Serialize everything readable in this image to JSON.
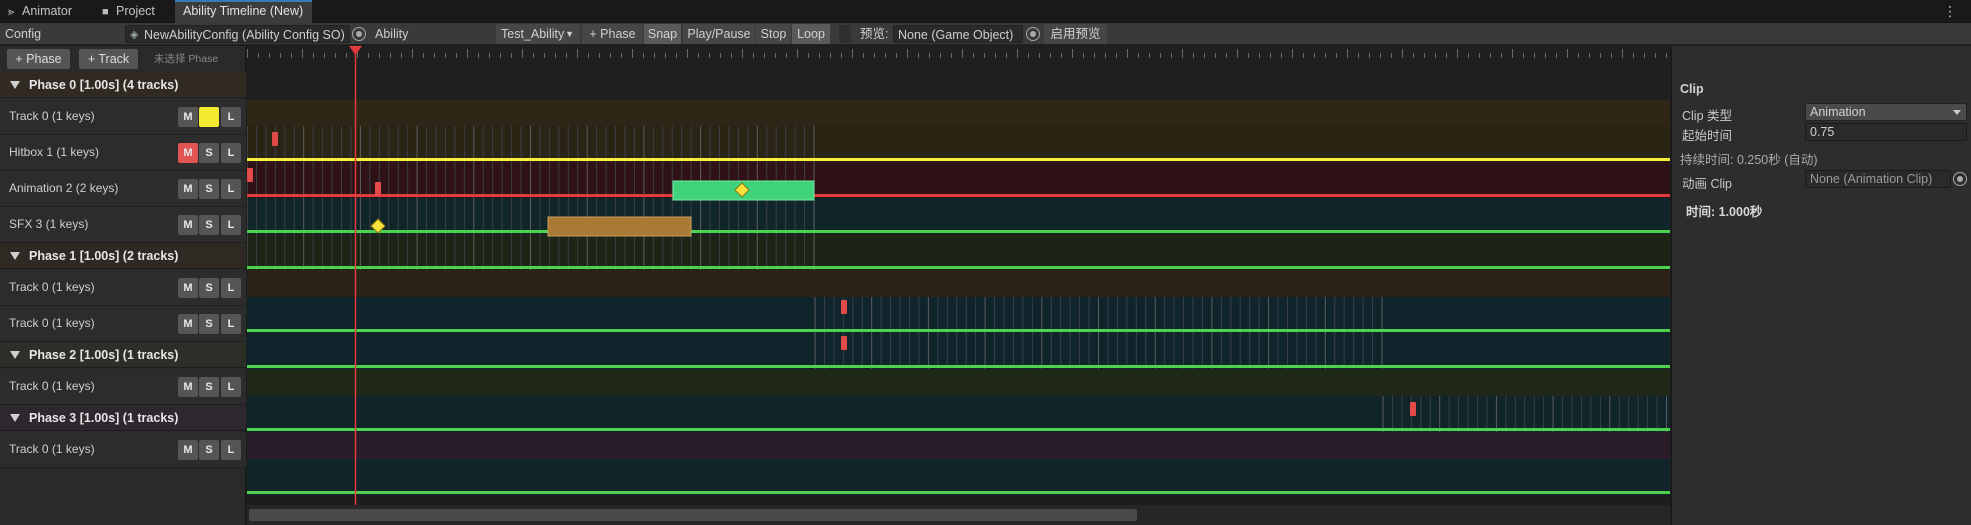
{
  "tabs": [
    {
      "label": "Animator",
      "icon": "animator-icon"
    },
    {
      "label": "Project",
      "icon": "folder-icon"
    },
    {
      "label": "Ability Timeline (New)",
      "icon": ""
    }
  ],
  "toolbar": {
    "config_label": "Config",
    "config_value": "NewAbilityConfig (Ability Config SO)",
    "ability_label": "Ability",
    "ability_value": "Test_Ability",
    "add_phase": "+ Phase",
    "snap": "Snap",
    "play_pause": "Play/Pause",
    "stop": "Stop",
    "loop": "Loop",
    "preview_label": "预览:",
    "preview_value": "None (Game Object)",
    "enable_preview": "启用预览"
  },
  "left": {
    "add_phase": "+ Phase",
    "add_track": "+ Track",
    "hint": "未选择 Phase"
  },
  "phases": [
    {
      "label": "Phase 0  [1.00s] (4 tracks)",
      "tracks": [
        {
          "label": "Track 0 (1 keys)",
          "m": "M",
          "s": "",
          "l": "L",
          "m_state": "normal",
          "s_state": "yellow"
        },
        {
          "label": "Hitbox 1 (1 keys)",
          "m": "M",
          "s": "S",
          "l": "L",
          "m_state": "red",
          "s_state": "normal"
        },
        {
          "label": "Animation 2 (2 keys)",
          "m": "M",
          "s": "S",
          "l": "L",
          "m_state": "normal",
          "s_state": "normal"
        },
        {
          "label": "SFX 3 (1 keys)",
          "m": "M",
          "s": "S",
          "l": "L",
          "m_state": "normal",
          "s_state": "normal"
        }
      ]
    },
    {
      "label": "Phase 1  [1.00s] (2 tracks)",
      "tracks": [
        {
          "label": "Track 0 (1 keys)",
          "m": "M",
          "s": "S",
          "l": "L",
          "m_state": "normal",
          "s_state": "normal"
        },
        {
          "label": "Track 0 (1 keys)",
          "m": "M",
          "s": "S",
          "l": "L",
          "m_state": "normal",
          "s_state": "normal"
        }
      ]
    },
    {
      "label": "Phase 2  [1.00s] (1 tracks)",
      "tracks": [
        {
          "label": "Track 0 (1 keys)",
          "m": "M",
          "s": "S",
          "l": "L",
          "m_state": "normal",
          "s_state": "normal"
        }
      ]
    },
    {
      "label": "Phase 3  [1.00s] (1 tracks)",
      "tracks": [
        {
          "label": "Track 0 (1 keys)",
          "m": "M",
          "s": "S",
          "l": "L",
          "m_state": "normal",
          "s_state": "normal"
        }
      ]
    }
  ],
  "inspector": {
    "title": "Clip",
    "clip_type_label": "Clip 类型",
    "clip_type_value": "Animation",
    "start_label": "起始时间",
    "start_value": "0.75",
    "duration_note": "持续时间: 0.250秒 (自动)",
    "anim_clip_label": "动画 Clip",
    "anim_clip_value": "None (Animation Clip)",
    "time_label": "时间: 1.000秒"
  },
  "colors": {
    "playhead": "#e23b3b",
    "track_line_yellow": "#f5f03a",
    "track_line_red": "#e13c3c",
    "track_line_green": "#4cd24c",
    "key_red": "#e24a4a",
    "key_diamond": "#f6e23c",
    "clip_green": "#3ed27a",
    "clip_orange": "#a87a36"
  }
}
